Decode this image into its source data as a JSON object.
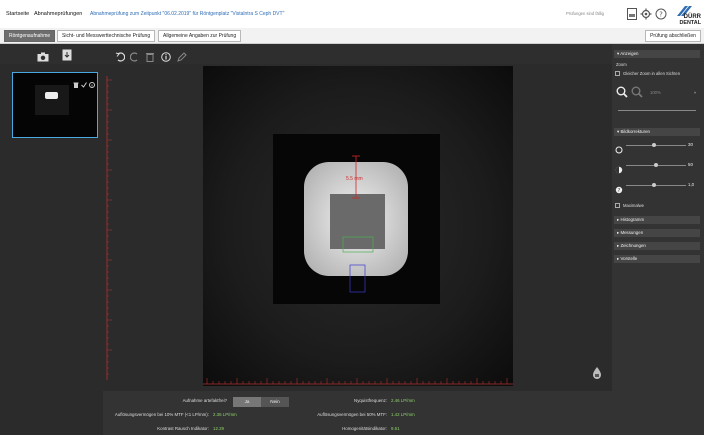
{
  "header": {
    "nav_home": "Startseite",
    "nav_tests": "Abnahmeprüfungen",
    "path_text": "Abnahmeprüfung zum Zeitpunkt \"06.02.2019\" für Röntgenplatz \"Vistalntra S Ceph DVT\"",
    "status_text": "Prüfungen sind fällig",
    "logo_line1": "DÜRR",
    "logo_line2": "DENTAL"
  },
  "tabs": [
    {
      "label": "Röntgenaufnahme",
      "active": true
    },
    {
      "label": "Sicht- und Messwerttechnische Prüfung",
      "active": false
    },
    {
      "label": "Allgemeine Angaben zur Prüfung",
      "active": false
    }
  ],
  "finish_button": "Prüfung abschließen",
  "viewer": {
    "measure_label": "5.5 mm"
  },
  "bottom": {
    "artifact_label": "Aufnahme artefaktfrei?",
    "yes": "Ja",
    "no": "Nein",
    "nyquist_label": "Nyquistfrequenz:",
    "nyquist_value": "2.46 LP/mm",
    "mtf10_label": "Auflösungsvermögen bei 10% MTF (<1 LP/mm):",
    "mtf10_value": "2.36 LP/mm",
    "mtf50_label": "Auflösungsvermögen bei 50% MTF:",
    "mtf50_value": "1.42 LP/mm",
    "contrast_label": "Kontrast Rausch Indikator:",
    "contrast_value": "12.29",
    "homog_label": "Homogenitätsindikator:",
    "homog_value": "9.51"
  },
  "right": {
    "anzeigen": "Anzeigen",
    "zoom": "Zoom",
    "same_zoom": "Gleicher Zoom in allen Sichten",
    "zoom_value": "100%",
    "bildkorrekturen": "Bildkorrekturen",
    "brightness": "30",
    "contrast": "50",
    "gamma": "1,0",
    "maximalwert": "Maximalwe",
    "histogramm": "Histogramm",
    "messungen": "Messungen",
    "zeichnungen": "Zeichnungen",
    "vorstelle": "Vorstelle"
  },
  "colors": {
    "accent": "#4aa8e0",
    "value_green": "#8fd16a",
    "measure_red": "#d22828"
  },
  "icons": [
    "camera-icon",
    "import-icon",
    "undo-icon",
    "redo-icon",
    "delete-icon",
    "info-icon",
    "edit-icon",
    "trash-icon",
    "check-icon",
    "help-icon",
    "settings-icon",
    "pdf-icon",
    "drop-icon"
  ]
}
